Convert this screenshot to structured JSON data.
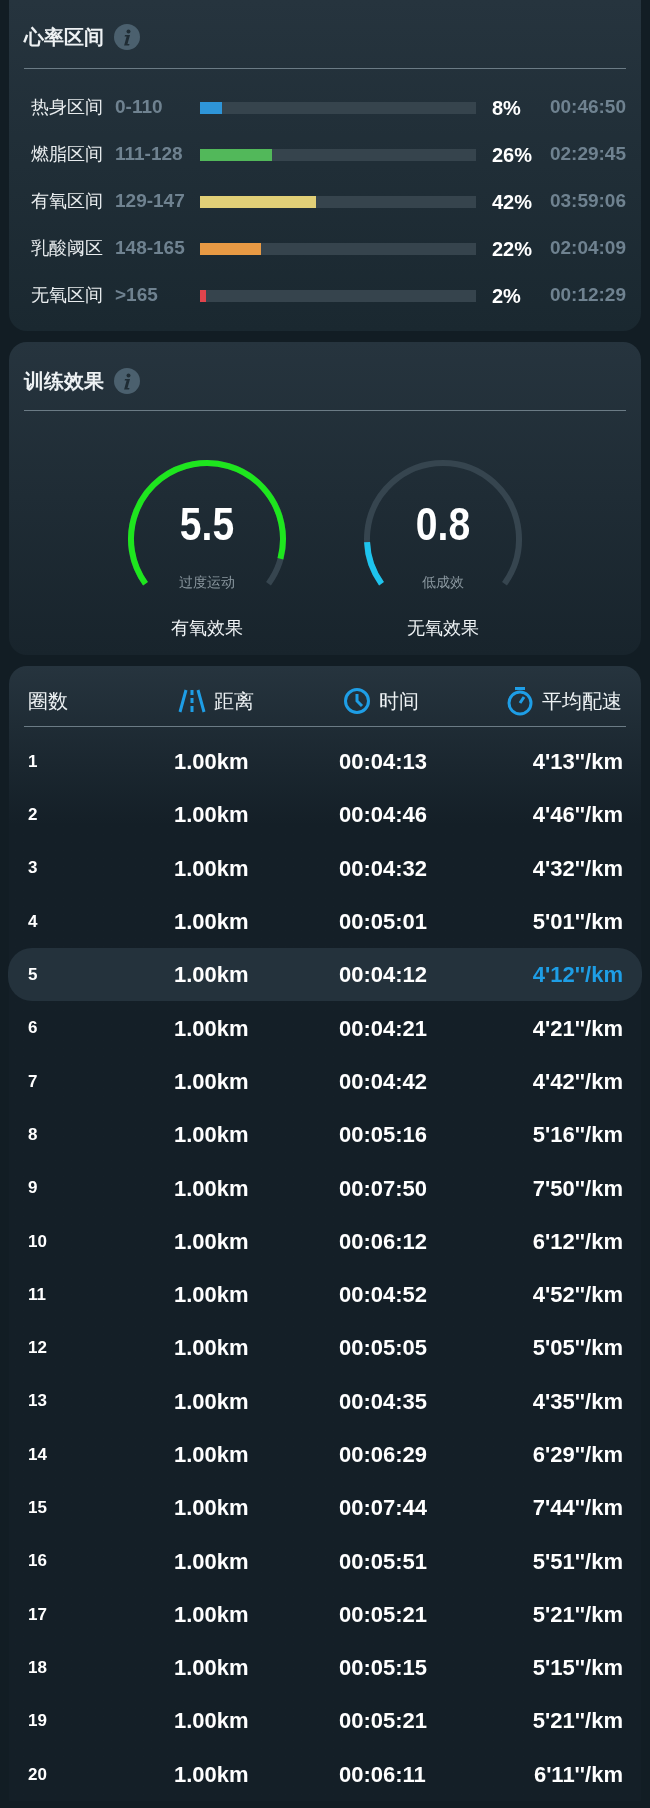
{
  "heart_rate_zones": {
    "title": "心率区间",
    "zones": [
      {
        "name": "热身区间",
        "range": "0-110",
        "level": 0.08,
        "color": "#2e95d8",
        "percent": "8%",
        "time": "00:46:50"
      },
      {
        "name": "燃脂区间",
        "range": "111-128",
        "level": 0.26,
        "color": "#52b85a",
        "percent": "26%",
        "time": "02:29:45"
      },
      {
        "name": "有氧区间",
        "range": "129-147",
        "level": 0.42,
        "color": "#e1cf77",
        "percent": "42%",
        "time": "03:59:06"
      },
      {
        "name": "乳酸阈区",
        "range": "148-165",
        "level": 0.22,
        "color": "#e89a44",
        "percent": "22%",
        "time": "02:04:09"
      },
      {
        "name": "无氧区间",
        "range": ">165",
        "level": 0.02,
        "color": "#e0444c",
        "percent": "2%",
        "time": "00:12:29"
      }
    ]
  },
  "training_effect": {
    "title": "训练效果",
    "gauges": [
      {
        "value": "5.5",
        "color": "#1ee61e",
        "status": "过度运动",
        "label": "有氧效果"
      },
      {
        "value": "0.8",
        "color": "#1ec4ee",
        "status": "低成效",
        "label": "无氧效果"
      }
    ]
  },
  "laps": {
    "columns": [
      "圈数",
      "距离",
      "时间",
      "平均配速"
    ],
    "rows": [
      {
        "lap": "1",
        "distance": "1.00km",
        "time": "00:04:13",
        "pace": "4'13''/km",
        "highlighted": false
      },
      {
        "lap": "2",
        "distance": "1.00km",
        "time": "00:04:46",
        "pace": "4'46''/km",
        "highlighted": false
      },
      {
        "lap": "3",
        "distance": "1.00km",
        "time": "00:04:32",
        "pace": "4'32''/km",
        "highlighted": false
      },
      {
        "lap": "4",
        "distance": "1.00km",
        "time": "00:05:01",
        "pace": "5'01''/km",
        "highlighted": false
      },
      {
        "lap": "5",
        "distance": "1.00km",
        "time": "00:04:12",
        "pace": "4'12''/km",
        "highlighted": true
      },
      {
        "lap": "6",
        "distance": "1.00km",
        "time": "00:04:21",
        "pace": "4'21''/km",
        "highlighted": false
      },
      {
        "lap": "7",
        "distance": "1.00km",
        "time": "00:04:42",
        "pace": "4'42''/km",
        "highlighted": false
      },
      {
        "lap": "8",
        "distance": "1.00km",
        "time": "00:05:16",
        "pace": "5'16''/km",
        "highlighted": false
      },
      {
        "lap": "9",
        "distance": "1.00km",
        "time": "00:07:50",
        "pace": "7'50''/km",
        "highlighted": false
      },
      {
        "lap": "10",
        "distance": "1.00km",
        "time": "00:06:12",
        "pace": "6'12''/km",
        "highlighted": false
      },
      {
        "lap": "11",
        "distance": "1.00km",
        "time": "00:04:52",
        "pace": "4'52''/km",
        "highlighted": false
      },
      {
        "lap": "12",
        "distance": "1.00km",
        "time": "00:05:05",
        "pace": "5'05''/km",
        "highlighted": false
      },
      {
        "lap": "13",
        "distance": "1.00km",
        "time": "00:04:35",
        "pace": "4'35''/km",
        "highlighted": false
      },
      {
        "lap": "14",
        "distance": "1.00km",
        "time": "00:06:29",
        "pace": "6'29''/km",
        "highlighted": false
      },
      {
        "lap": "15",
        "distance": "1.00km",
        "time": "00:07:44",
        "pace": "7'44''/km",
        "highlighted": false
      },
      {
        "lap": "16",
        "distance": "1.00km",
        "time": "00:05:51",
        "pace": "5'51''/km",
        "highlighted": false
      },
      {
        "lap": "17",
        "distance": "1.00km",
        "time": "00:05:21",
        "pace": "5'21''/km",
        "highlighted": false
      },
      {
        "lap": "18",
        "distance": "1.00km",
        "time": "00:05:15",
        "pace": "5'15''/km",
        "highlighted": false
      },
      {
        "lap": "19",
        "distance": "1.00km",
        "time": "00:05:21",
        "pace": "5'21''/km",
        "highlighted": false
      },
      {
        "lap": "20",
        "distance": "1.00km",
        "time": "00:06:11",
        "pace": "6'11''/km",
        "highlighted": false
      }
    ]
  }
}
